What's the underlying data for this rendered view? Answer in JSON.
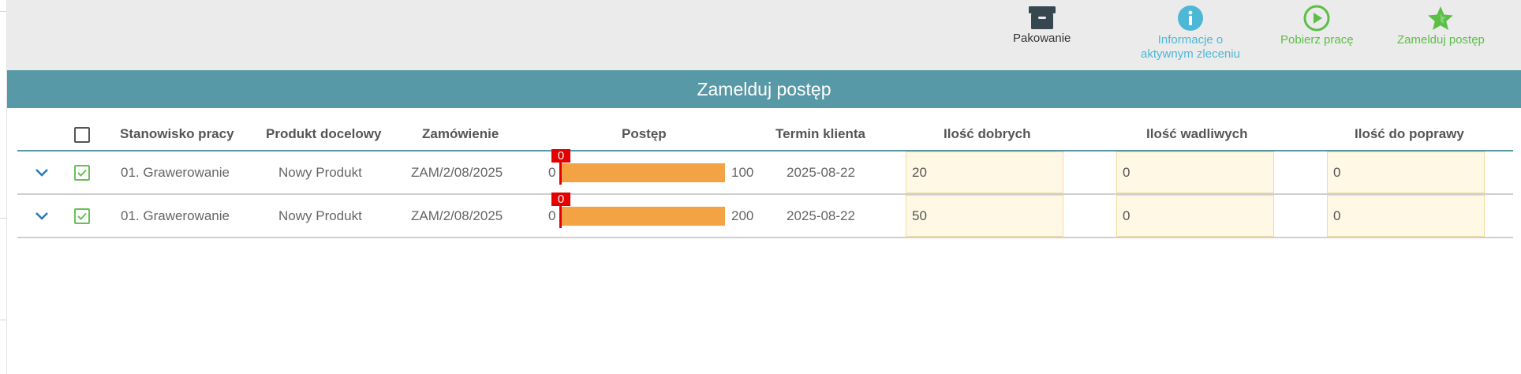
{
  "toolbar": {
    "packing": {
      "label": "Pakowanie",
      "icon": "archive-box-icon",
      "color": "#333333"
    },
    "info": {
      "label": "Informacje o\naktywnym zleceniu",
      "icon": "info-circle-icon",
      "color": "#4db8d5"
    },
    "fetch": {
      "label": "Pobierz pracę",
      "icon": "play-circle-icon",
      "color": "#5bbf46"
    },
    "report": {
      "label": "Zamelduj postęp",
      "icon": "star-icon",
      "color": "#5bbf46"
    }
  },
  "title": "Zamelduj postęp",
  "columns": {
    "station": "Stanowisko pracy",
    "product": "Produkt docelowy",
    "order": "Zamówienie",
    "progress": "Postęp",
    "deadline": "Termin klienta",
    "good": "Ilość dobrych",
    "defective": "Ilość wadliwych",
    "rework": "Ilość do poprawy"
  },
  "rows": [
    {
      "station": "01. Grawerowanie",
      "product": "Nowy Produkt",
      "order": "ZAM/2/08/2025",
      "progress_start": "0",
      "progress_marker": "0",
      "progress_end": "100",
      "deadline": "2025-08-22",
      "good": "20",
      "defective": "0",
      "rework": "0"
    },
    {
      "station": "01. Grawerowanie",
      "product": "Nowy Produkt",
      "order": "ZAM/2/08/2025",
      "progress_start": "0",
      "progress_marker": "0",
      "progress_end": "200",
      "deadline": "2025-08-22",
      "good": "50",
      "defective": "0",
      "rework": "0"
    }
  ],
  "colors": {
    "accent": "#5799a6",
    "progress_bar": "#f3a244",
    "marker": "#e20000",
    "input_bg": "#fef8e5"
  }
}
